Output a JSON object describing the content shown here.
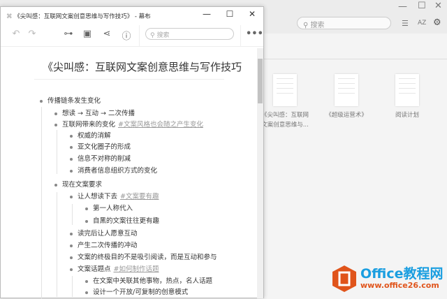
{
  "background_app": {
    "search_placeholder": "搜索",
    "sort_label": "AZ",
    "documents": [
      {
        "title": "《尖叫感：互联网",
        "title2": "文案创意思维与..."
      },
      {
        "title": "《超级运营术》"
      },
      {
        "title": "阅读计划"
      }
    ]
  },
  "window": {
    "title": "《尖叫感：互联网文案创意思维与写作技巧》 - 幕布",
    "search_placeholder": "搜索"
  },
  "document": {
    "title": "《尖叫感：互联网文案创意思维与写作技巧",
    "items": [
      {
        "text": "传播链条发生变化",
        "level": 0
      },
      {
        "text": "想读 → 互动 → 二次传播",
        "level": 1
      },
      {
        "text": "互联网带来的变化",
        "tag": "#文案风格也会随之产生变化",
        "level": 1
      },
      {
        "text": "权威的消解",
        "level": 2
      },
      {
        "text": "亚文化圈子的形成",
        "level": 2
      },
      {
        "text": "信息不对称的削减",
        "level": 2
      },
      {
        "text": "消费者信息组织方式的变化",
        "level": 2
      },
      {
        "text": "现在文案要求",
        "level": 1
      },
      {
        "text": "让人想读下去",
        "tag": "#文案要有趣",
        "level": 2
      },
      {
        "text": "第一人称代入",
        "level": 3
      },
      {
        "text": "自黑的文案往往更有趣",
        "level": 3
      },
      {
        "text": "读完后让人愿意互动",
        "level": 2
      },
      {
        "text": "产生二次传播的冲动",
        "level": 2
      },
      {
        "text": "文案的终极目的不是吸引阅读，而是互动和参与",
        "level": 2
      },
      {
        "text": "文案话题点",
        "tag": "#如何制作话题",
        "level": 2
      },
      {
        "text": "在文案中关联其他事物，热点，名人话题",
        "level": 3
      },
      {
        "text": "设计一个开放/可复制的创意模式",
        "level": 3
      }
    ]
  },
  "watermark": {
    "brand": "Office教程网",
    "url": "www.office26.com",
    "color_blue": "#1a9ee0",
    "color_orange": "#e0541b"
  }
}
